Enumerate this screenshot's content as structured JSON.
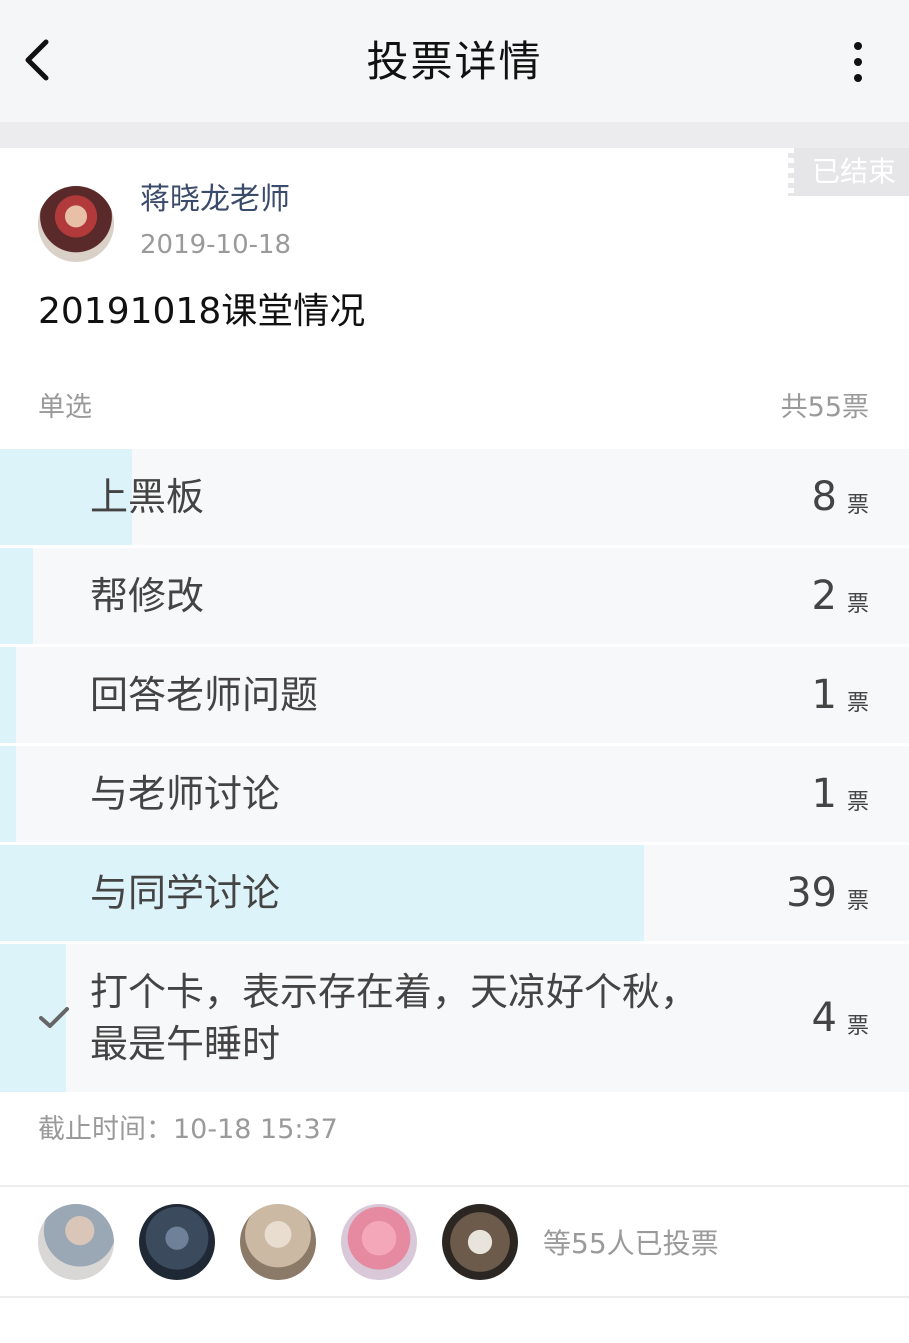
{
  "header": {
    "title": "投票详情",
    "back_icon": "chevron-left-icon",
    "more_icon": "more-vertical-icon"
  },
  "status_tag": "已结束",
  "author": {
    "name": "蒋晓龙老师",
    "date": "2019-10-18"
  },
  "poll": {
    "title": "20191018课堂情况",
    "type": "单选",
    "total": "共55票",
    "vote_unit": "票",
    "options": [
      {
        "label": "上黑板",
        "votes": "8",
        "share": 0.145,
        "selected": false
      },
      {
        "label": "帮修改",
        "votes": "2",
        "share": 0.036,
        "selected": false
      },
      {
        "label": "回答老师问题",
        "votes": "1",
        "share": 0.018,
        "selected": false
      },
      {
        "label": "与老师讨论",
        "votes": "1",
        "share": 0.018,
        "selected": false
      },
      {
        "label": "与同学讨论",
        "votes": "39",
        "share": 0.709,
        "selected": false
      },
      {
        "label": "打个卡，表示存在着，天凉好个秋，最是午睡时",
        "votes": "4",
        "share": 0.073,
        "selected": true
      }
    ],
    "deadline": "截止时间：10-18 15:37"
  },
  "voters": {
    "summary": "等55人已投票"
  },
  "colors": {
    "fill": "#ddf3fa",
    "row_bg": "#f7f8fa",
    "author": "#3b4b6b",
    "muted": "#9a9a9a"
  }
}
